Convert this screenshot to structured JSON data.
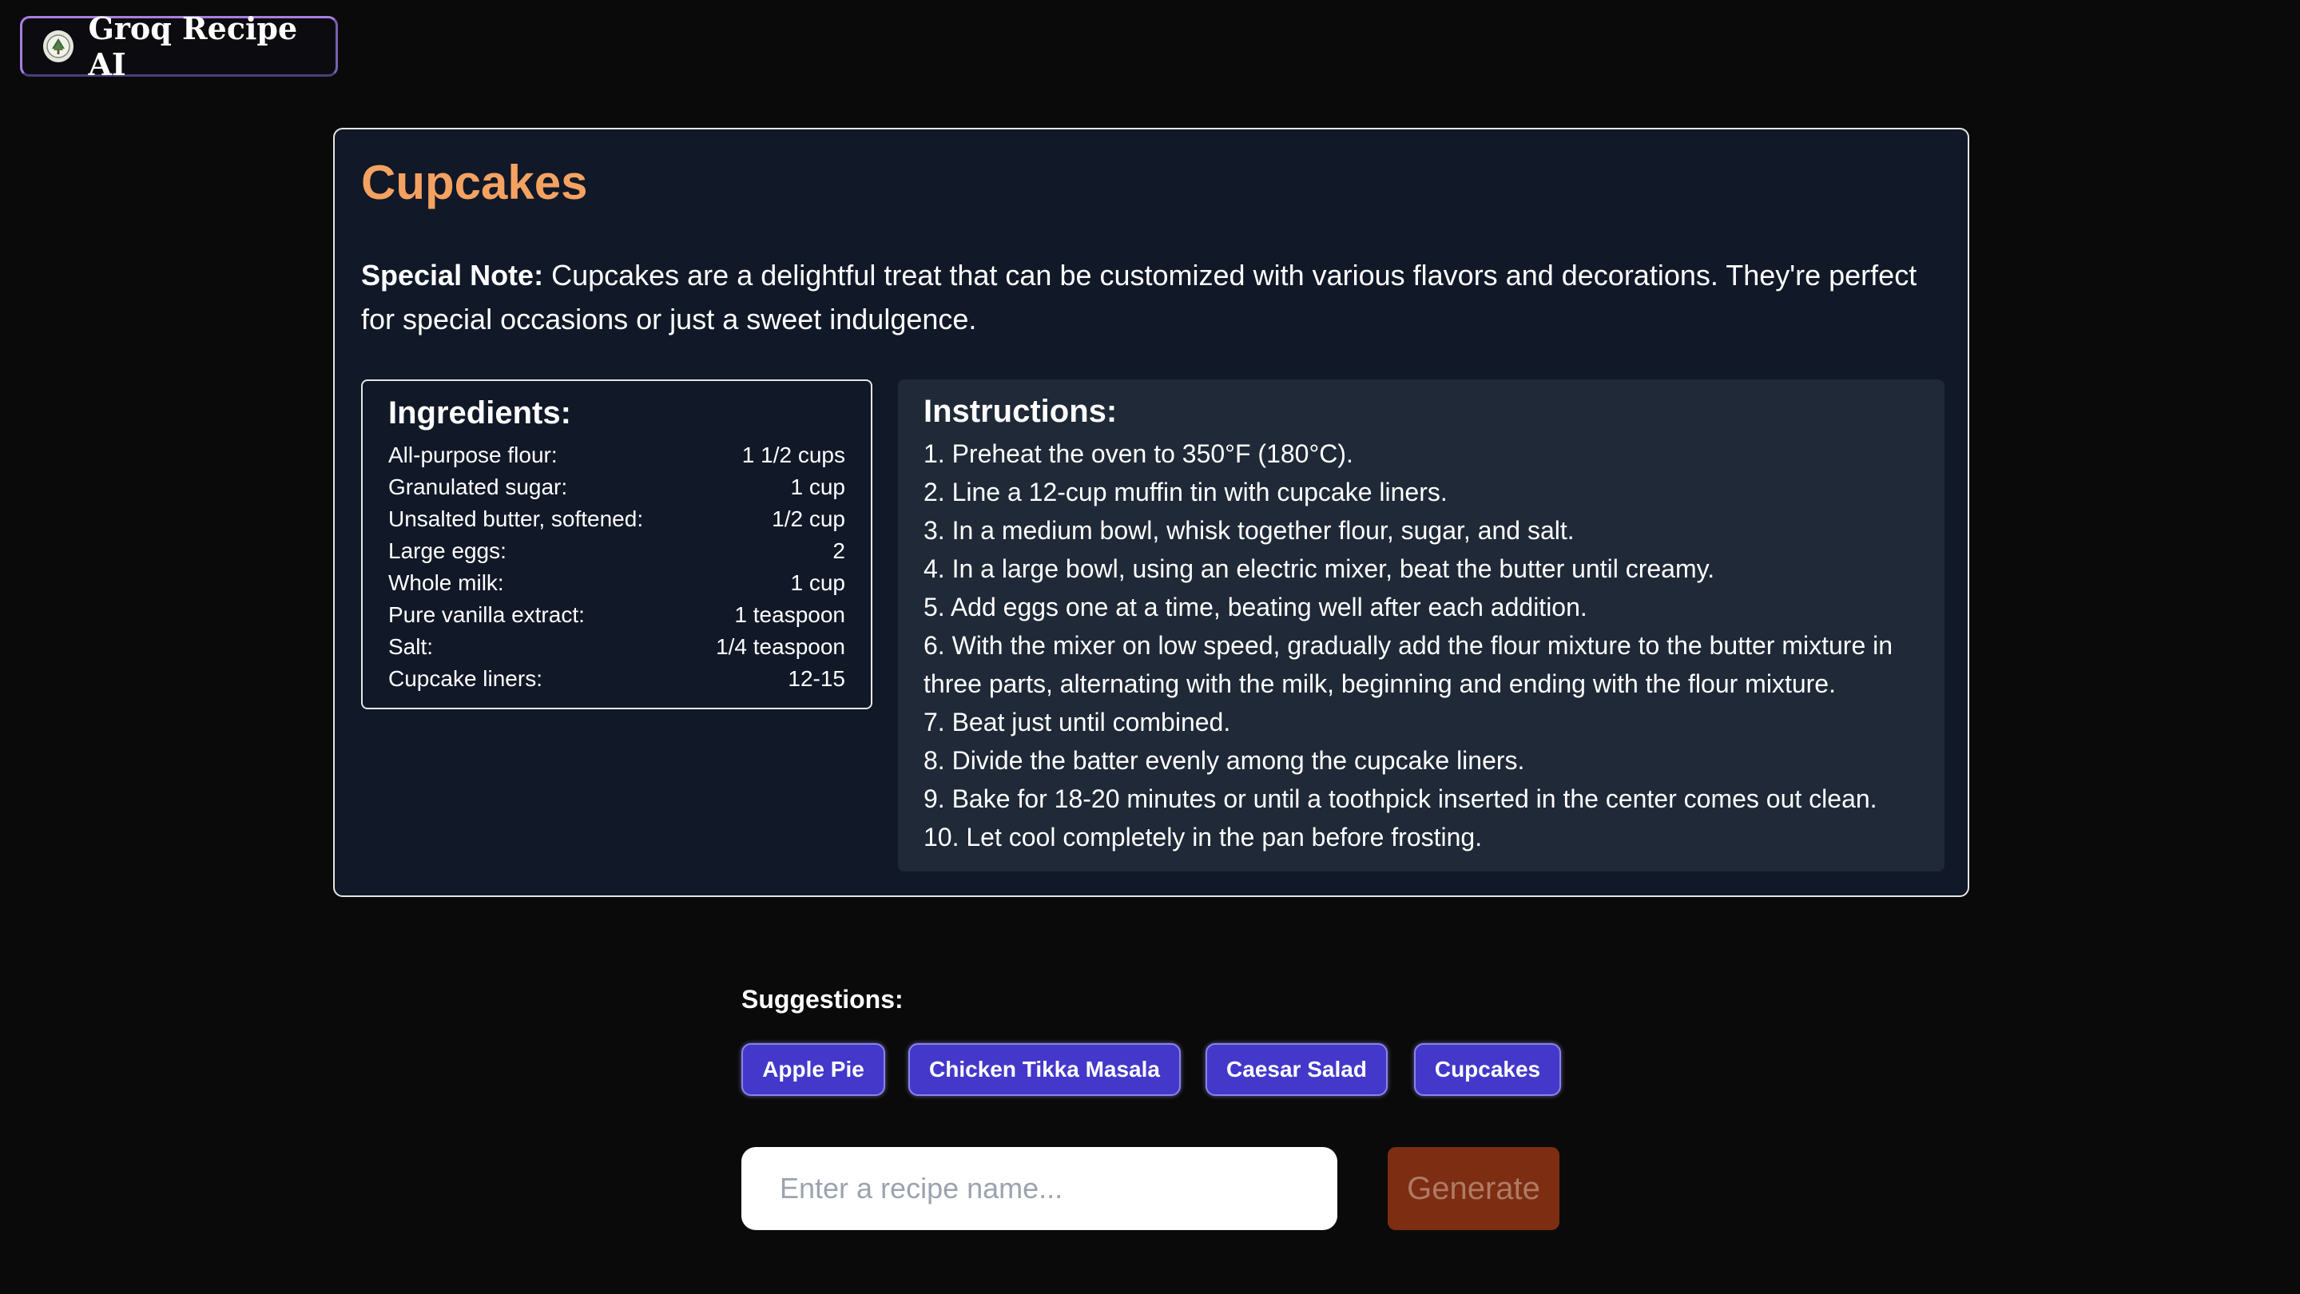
{
  "app": {
    "title": "Groq Recipe AI",
    "logo_icon": "tree-emblem-icon"
  },
  "recipe": {
    "title": "Cupcakes",
    "special_note_label": "Special Note:",
    "special_note_text": "Cupcakes are a delightful treat that can be customized with various flavors and decorations. They're perfect for special occasions or just a sweet indulgence.",
    "ingredients_heading": "Ingredients:",
    "ingredients": [
      {
        "name": "All-purpose flour:",
        "amount": "1 1/2 cups"
      },
      {
        "name": "Granulated sugar:",
        "amount": "1 cup"
      },
      {
        "name": "Unsalted butter, softened:",
        "amount": "1/2 cup"
      },
      {
        "name": "Large eggs:",
        "amount": "2"
      },
      {
        "name": "Whole milk:",
        "amount": "1 cup"
      },
      {
        "name": "Pure vanilla extract:",
        "amount": "1 teaspoon"
      },
      {
        "name": "Salt:",
        "amount": "1/4 teaspoon"
      },
      {
        "name": "Cupcake liners:",
        "amount": "12-15"
      }
    ],
    "instructions_heading": "Instructions:",
    "instructions": [
      "1. Preheat the oven to 350°F (180°C).",
      "2. Line a 12-cup muffin tin with cupcake liners.",
      "3. In a medium bowl, whisk together flour, sugar, and salt.",
      "4. In a large bowl, using an electric mixer, beat the butter until creamy.",
      "5. Add eggs one at a time, beating well after each addition.",
      "6. With the mixer on low speed, gradually add the flour mixture to the butter mixture in three parts, alternating with the milk, beginning and ending with the flour mixture.",
      "7. Beat just until combined.",
      "8. Divide the batter evenly among the cupcake liners.",
      "9. Bake for 18-20 minutes or until a toothpick inserted in the center comes out clean.",
      "10. Let cool completely in the pan before frosting."
    ]
  },
  "suggestions": {
    "label": "Suggestions:",
    "items": [
      "Apple Pie",
      "Chicken Tikka Masala",
      "Caesar Salad",
      "Cupcakes"
    ]
  },
  "search": {
    "value": "",
    "placeholder": "Enter a recipe name...",
    "button_label": "Generate"
  },
  "colors": {
    "title_accent": "#f4a261",
    "chip_bg": "#4338ca",
    "generate_bg": "#7c2d12",
    "card_bg": "#111827",
    "instructions_bg": "#1f2937"
  }
}
